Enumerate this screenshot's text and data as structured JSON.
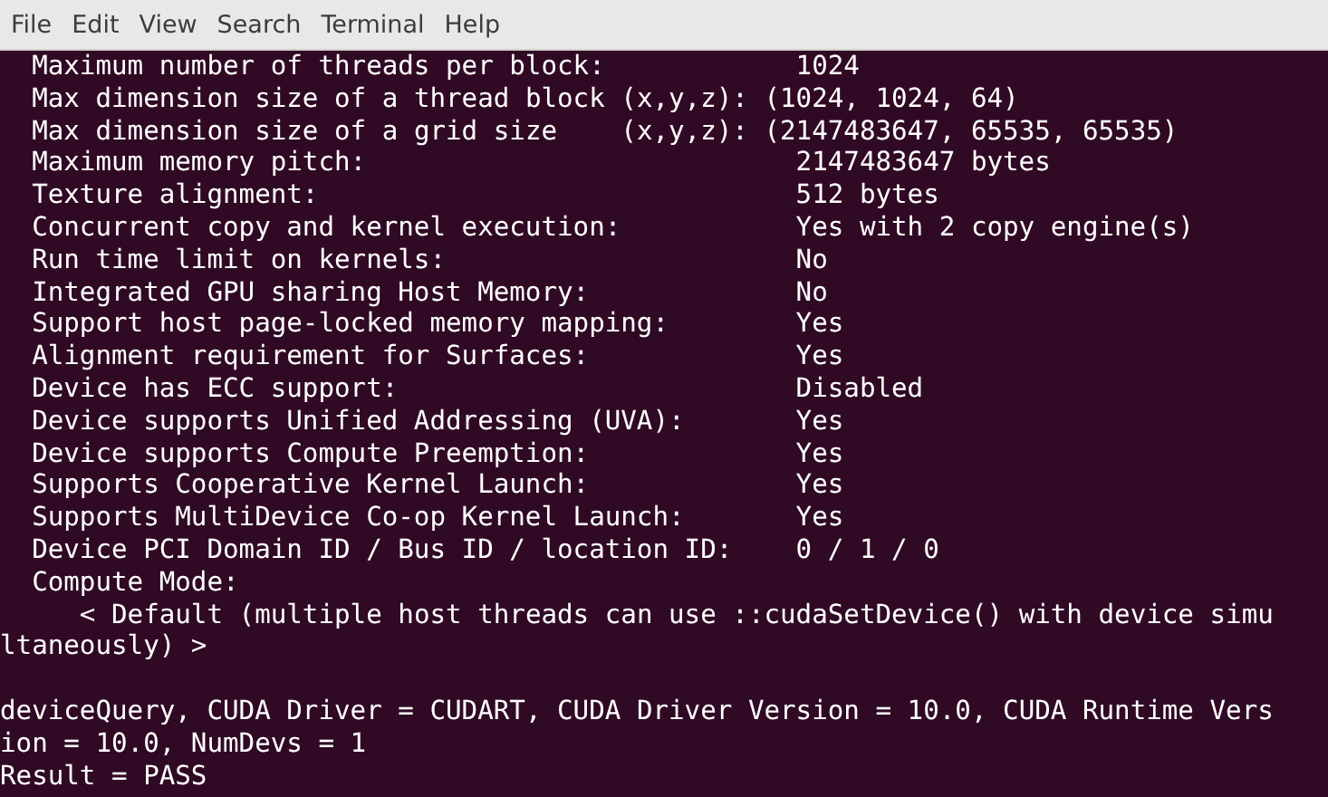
{
  "menu": [
    "File",
    "Edit",
    "View",
    "Search",
    "Terminal",
    "Help"
  ],
  "blocks": [
    [
      {
        "kind": "pair",
        "label": "Maximum number of threads per block:",
        "value": "1024"
      },
      {
        "kind": "text",
        "text": "  Max dimension size of a thread block (x,y,z): (1024, 1024, 64)"
      },
      {
        "kind": "text",
        "text": "  Max dimension size of a grid size    (x,y,z): (2147483647, 65535, 65535)"
      },
      {
        "kind": "pair",
        "label": "Maximum memory pitch:",
        "value": "2147483647 bytes"
      },
      {
        "kind": "pair",
        "label": "Texture alignment:",
        "value": "512 bytes"
      },
      {
        "kind": "pair",
        "label": "Concurrent copy and kernel execution:",
        "value": "Yes with 2 copy engine(s)"
      },
      {
        "kind": "pair",
        "label": "Run time limit on kernels:",
        "value": "No"
      },
      {
        "kind": "pair",
        "label": "Integrated GPU sharing Host Memory:",
        "value": "No"
      },
      {
        "kind": "pair",
        "label": "Support host page-locked memory mapping:",
        "value": "Yes"
      },
      {
        "kind": "pair",
        "label": "Alignment requirement for Surfaces:",
        "value": "Yes"
      },
      {
        "kind": "pair",
        "label": "Device has ECC support:",
        "value": "Disabled"
      },
      {
        "kind": "pair",
        "label": "Device supports Unified Addressing (UVA):",
        "value": "Yes"
      },
      {
        "kind": "pair",
        "label": "Device supports Compute Preemption:",
        "value": "Yes"
      },
      {
        "kind": "pair",
        "label": "Supports Cooperative Kernel Launch:",
        "value": "Yes"
      },
      {
        "kind": "pair",
        "label": "Supports MultiDevice Co-op Kernel Launch:",
        "value": "Yes"
      },
      {
        "kind": "pair",
        "label": "Device PCI Domain ID / Bus ID / location ID:",
        "value": "0 / 1 / 0"
      },
      {
        "kind": "pair",
        "label": "Compute Mode:"
      },
      {
        "kind": "text",
        "text": "     < Default (multiple host threads can use ::cudaSetDevice() with device simu"
      },
      {
        "kind": "text",
        "text": "ltaneously) >"
      }
    ],
    [
      {
        "kind": "text",
        "text": "deviceQuery, CUDA Driver = CUDART, CUDA Driver Version = 10.0, CUDA Runtime Vers"
      },
      {
        "kind": "text",
        "text": "ion = 10.0, NumDevs = 1"
      },
      {
        "kind": "text",
        "text": "Result = PASS"
      }
    ]
  ]
}
